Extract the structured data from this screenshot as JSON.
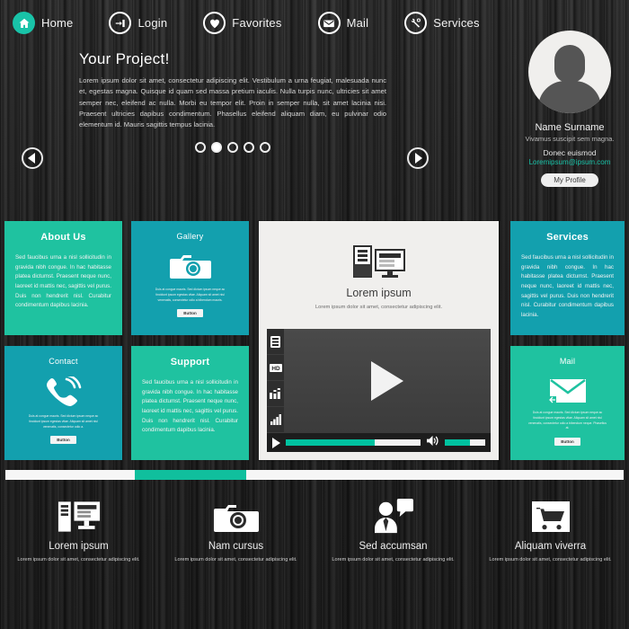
{
  "nav": {
    "items": [
      {
        "label": "Home",
        "icon": "home-icon",
        "active": true
      },
      {
        "label": "Login",
        "icon": "login-icon",
        "active": false
      },
      {
        "label": "Favorites",
        "icon": "heart-icon",
        "active": false
      },
      {
        "label": "Mail",
        "icon": "envelope-icon",
        "active": false
      },
      {
        "label": "Services",
        "icon": "wrench-icon",
        "active": false
      }
    ]
  },
  "hero": {
    "title": "Your Project!",
    "text": "Lorem ipsum dolor sit amet, consectetur adipiscing elit. Vestibulum a urna feugiat, malesuada nunc et, egestas magna. Quisque id quam sed massa pretium iaculis. Nulla turpis nunc, ultricies sit amet semper nec, eleifend ac nulla. Morbi eu tempor elit. Proin in semper nulla, sit amet lacinia nisi. Praesent ultricies dapibus condimentum. Phasellus eleifend aliquam diam, eu pulvinar odio elementum id. Mauris sagittis tempus lacinia.",
    "prev_icon": "chevron-left-icon",
    "next_icon": "chevron-right-icon",
    "dots_total": 5,
    "dot_active_index": 1
  },
  "profile": {
    "avatar_icon": "user-avatar-icon",
    "name": "Name Surname",
    "tagline": "Vivamus suscipit sem magna.",
    "label": "Donec euismod",
    "email": "Loremipsum@ipsum.com",
    "button": "My Profile",
    "email_color": "#19c3a8"
  },
  "cards": {
    "about": {
      "title": "About Us",
      "text": "Sed faucibus urna a nisl sollicitudin in gravida nibh congue. In hac habitasse platea dictumst. Praesent neque nunc, laoreet id mattis nec, sagittis vel purus. Duis non hendrerit nisl. Curabitur condimentum dapibus lacinia."
    },
    "gallery": {
      "title": "Gallery",
      "icon": "camera-icon",
      "text": "Duis at congue mauris. Sed dictum ipsum neque ac tincidunt ipsum egestas vitae. Aliquam sit amet nisl venenatis, consectetur odio a bibendum mauris.",
      "button": "Button"
    },
    "contact": {
      "title": "Contact",
      "icon": "phone-ringing-icon",
      "text": "Duis at congue mauris. Sed dictum ipsum neque ac tincidunt ipsum egestas vitae. Aliquam sit amet nisl venenatis, consectetur odio a.",
      "button": "Button"
    },
    "support": {
      "title": "Support",
      "text": "Sed faucibus urna a nisl sollicitudin in gravida nibh congue. In hac habitasse platea dictumst. Praesent neque nunc, laoreet id mattis nec, sagittis vel purus. Duis non hendrerit nisl. Curabitur condimentum dapibus lacinia."
    },
    "services": {
      "title": "Services",
      "text": "Sed faucibus urna a nisl sollicitudin in gravida nibh congue. In hac habitasse platea dictumst. Praesent neque nunc, laoreet id mattis nec, sagittis vel purus. Duis non hendrerit nisl. Curabitur condimentum dapibus lacinia."
    },
    "mail": {
      "title": "Mail",
      "icon": "envelope-icon",
      "text": "Duis at congue mauris. Sed dictum ipsum neque ac tincidunt ipsum egestas vitae. Aliquam sit amet nisl venenatis, consectetur odio a bibendum neque. Phasellus at.",
      "button": "Button"
    },
    "color_light": "#1fc2a0",
    "color_dark": "#13a0ae"
  },
  "panel": {
    "icon": "desktop-computer-icon",
    "heading": "Lorem ipsum",
    "subtext": "Lorem ipsum dolor sit amet, consectetur adipiscing elit.",
    "player": {
      "side_icons": [
        "playlist-icon",
        "hd-icon",
        "equalizer-icon",
        "signal-bars-icon"
      ],
      "hd_label": "HD",
      "big_play_icon": "play-icon",
      "play_icon": "play-icon",
      "volume_icon": "volume-icon",
      "progress_percent": 66,
      "volume_percent": 62,
      "accent": "#00c2a0"
    }
  },
  "progress_bar": {
    "start_percent": 21,
    "end_percent": 39,
    "accent": "#10bf9d"
  },
  "features": [
    {
      "icon": "desktop-computer-icon",
      "title": "Lorem ipsum",
      "text": "Lorem ipsum dolor sit amet, consectetur adipiscing elit."
    },
    {
      "icon": "camera-icon",
      "title": "Nam cursus",
      "text": "Lorem ipsum dolor sit amet, consectetur adipiscing elit."
    },
    {
      "icon": "person-chat-icon",
      "title": "Sed accumsan",
      "text": "Lorem ipsum dolor sit amet, consectetur adipiscing elit."
    },
    {
      "icon": "shopping-cart-icon",
      "title": "Aliquam viverra",
      "text": "Lorem ipsum dolor sit amet, consectetur adipiscing elit."
    }
  ]
}
